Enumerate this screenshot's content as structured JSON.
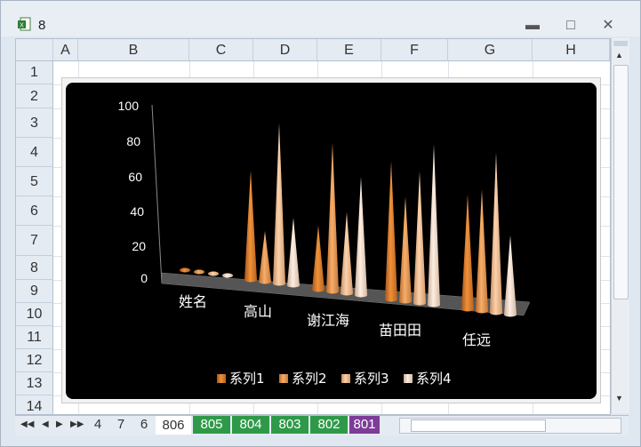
{
  "window": {
    "title": "8",
    "icon": "excel-icon"
  },
  "columns": [
    "A",
    "B",
    "C",
    "D",
    "E",
    "F",
    "G",
    "H"
  ],
  "rows": [
    "1",
    "2",
    "3",
    "4",
    "5",
    "6",
    "7",
    "8",
    "9",
    "10",
    "11",
    "12",
    "13",
    "14"
  ],
  "sheet_tabs": [
    "4",
    "7",
    "6",
    "806",
    "805",
    "804",
    "803",
    "802",
    "801"
  ],
  "active_tab": "806",
  "colors": {
    "series1": "#e9852a",
    "series2": "#f2a45c",
    "series3": "#f7c79b",
    "series4": "#f8e2d0",
    "tab_green": "#2e9a49",
    "tab_purple": "#7d3c98"
  },
  "chart_data": {
    "type": "bar",
    "subtype": "3d-cone",
    "categories": [
      "姓名",
      "高山",
      "谢江海",
      "苗田田",
      "任远"
    ],
    "series": [
      {
        "name": "系列1",
        "values": [
          0,
          65,
          38,
          82,
          68
        ]
      },
      {
        "name": "系列2",
        "values": [
          0,
          30,
          88,
          62,
          72
        ]
      },
      {
        "name": "系列3",
        "values": [
          0,
          95,
          48,
          78,
          95
        ]
      },
      {
        "name": "系列4",
        "values": [
          0,
          40,
          70,
          95,
          47
        ]
      }
    ],
    "yticks": [
      "100",
      "80",
      "60",
      "40",
      "20",
      "0"
    ],
    "ylim": [
      0,
      100
    ],
    "legend_position": "bottom",
    "background": "black"
  }
}
